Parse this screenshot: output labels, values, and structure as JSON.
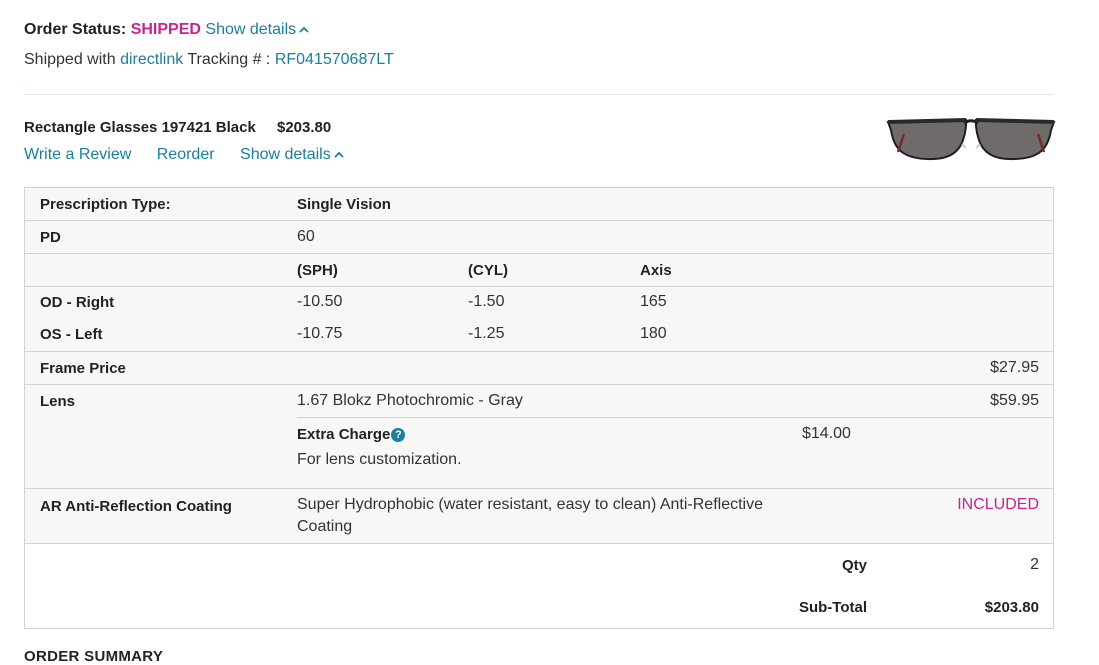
{
  "status": {
    "label": "Order Status:",
    "value": "SHIPPED",
    "show_details": "Show details",
    "shipped_with": "Shipped with",
    "carrier": "directlink",
    "tracking_label": "Tracking # :",
    "tracking_number": "RF041570687LT"
  },
  "product": {
    "name": "Rectangle Glasses 197421 Black",
    "price": "$203.80",
    "actions": {
      "write_review": "Write a Review",
      "reorder": "Reorder",
      "show_details": "Show details"
    },
    "image_icon": "glasses-image"
  },
  "details": {
    "prescription_type": {
      "label": "Prescription Type:",
      "value": "Single Vision"
    },
    "pd": {
      "label": "PD",
      "value": "60"
    },
    "columns": {
      "sph": "(SPH)",
      "cyl": "(CYL)",
      "axis": "Axis"
    },
    "od": {
      "label": "OD - Right",
      "sph": "-10.50",
      "cyl": "-1.50",
      "axis": "165"
    },
    "os": {
      "label": "OS - Left",
      "sph": "-10.75",
      "cyl": "-1.25",
      "axis": "180"
    },
    "frame_price": {
      "label": "Frame Price",
      "value": "$27.95"
    },
    "lens": {
      "label": "Lens",
      "value": "1.67 Blokz Photochromic - Gray",
      "price": "$59.95",
      "extra_label": "Extra Charge",
      "extra_help": "?",
      "extra_desc": "For lens customization.",
      "extra_price": "$14.00"
    },
    "coating": {
      "label": "AR Anti-Reflection Coating",
      "value_line1": "Super Hydrophobic (water resistant, easy to clean) Anti-Reflective",
      "value_line2": "Coating",
      "price": "INCLUDED"
    },
    "qty": {
      "label": "Qty",
      "value": "2"
    },
    "subtotal": {
      "label": "Sub-Total",
      "value": "$203.80"
    }
  },
  "order_summary": {
    "title": "ORDER SUMMARY"
  },
  "colors": {
    "accent": "#c5258f",
    "link": "#1a7f9a",
    "border": "#d3d3d3",
    "row_bg": "#f7f7f7"
  }
}
